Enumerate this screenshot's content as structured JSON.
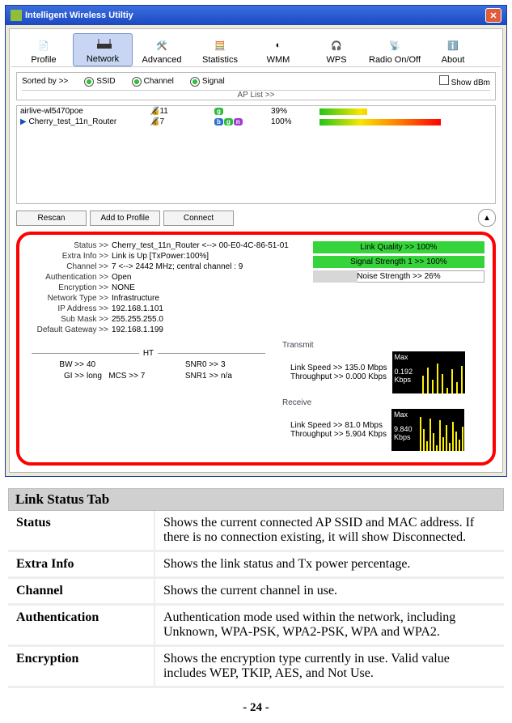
{
  "window": {
    "title": "Intelligent Wireless Utiltiy"
  },
  "toolbar": {
    "profile": "Profile",
    "network": "Network",
    "advanced": "Advanced",
    "statistics": "Statistics",
    "wmm": "WMM",
    "wps": "WPS",
    "radio": "Radio On/Off",
    "about": "About"
  },
  "sortbar": {
    "sortedby": "Sorted by >>",
    "ssid": "SSID",
    "channel": "Channel",
    "signal": "Signal",
    "showdbm": "Show dBm",
    "aplist": "AP List >>"
  },
  "aps": [
    {
      "ssid": "airlive-wl5470poe",
      "channel": "11",
      "bands": [
        "g"
      ],
      "signal": 39,
      "pct": "39%"
    },
    {
      "ssid": "Cherry_test_11n_Router",
      "channel": "7",
      "bands": [
        "b",
        "g",
        "n"
      ],
      "signal": 100,
      "pct": "100%"
    }
  ],
  "buttons": {
    "rescan": "Rescan",
    "addprofile": "Add to Profile",
    "connect": "Connect"
  },
  "status": {
    "labels": {
      "status": "Status >>",
      "extra": "Extra Info >>",
      "channel": "Channel >>",
      "auth": "Authentication >>",
      "enc": "Encryption >>",
      "nettype": "Network Type >>",
      "ip": "IP Address >>",
      "mask": "Sub Mask >>",
      "gw": "Default Gateway >>"
    },
    "values": {
      "status": "Cherry_test_11n_Router <--> 00-E0-4C-86-51-01",
      "extra": "Link is Up [TxPower:100%]",
      "channel": "7 <--> 2442 MHz; central channel : 9",
      "auth": "Open",
      "enc": "NONE",
      "nettype": "Infrastructure",
      "ip": "192.168.1.101",
      "mask": "255.255.255.0",
      "gw": "192.168.1.199"
    }
  },
  "quality": {
    "link": "Link Quality >> 100%",
    "sig1": "Signal Strength 1 >> 100%",
    "noise": "Noise Strength >> 26%"
  },
  "transmit": {
    "title": "Transmit",
    "speed_lab": "Link Speed >>",
    "speed_val": "135.0 Mbps",
    "tp_lab": "Throughput >>",
    "tp_val": "0.000 Kbps",
    "max": "Max",
    "maxval": "0.192",
    "unit": "Kbps"
  },
  "receive": {
    "title": "Receive",
    "speed_lab": "Link Speed >>",
    "speed_val": "81.0 Mbps",
    "tp_lab": "Throughput >>",
    "tp_val": "5.904 Kbps",
    "max": "Max",
    "maxval": "9.840",
    "unit": "Kbps"
  },
  "ht": {
    "title": "HT",
    "bw_lab": "BW >>",
    "bw": "40",
    "gi_lab": "GI >>",
    "gi": "long",
    "mcs_lab": "MCS >>",
    "mcs": "7",
    "snr0_lab": "SNR0 >>",
    "snr0": "3",
    "snr1_lab": "SNR1 >>",
    "snr1": "n/a"
  },
  "doc": {
    "title": "Link Status Tab",
    "rows": [
      {
        "k": "Status",
        "v": "Shows the current connected AP SSID and MAC address. If there is no connection existing, it will show Disconnected."
      },
      {
        "k": "Extra Info",
        "v": "Shows the link status and Tx power percentage."
      },
      {
        "k": "Channel",
        "v": "Shows the current channel in use."
      },
      {
        "k": "Authentication",
        "v": "Authentication mode used within the network, including Unknown, WPA-PSK, WPA2-PSK, WPA and WPA2."
      },
      {
        "k": "Encryption",
        "v": "Shows the encryption type currently in use. Valid value includes WEP, TKIP, AES, and Not Use."
      }
    ]
  },
  "page": "- 24 -"
}
